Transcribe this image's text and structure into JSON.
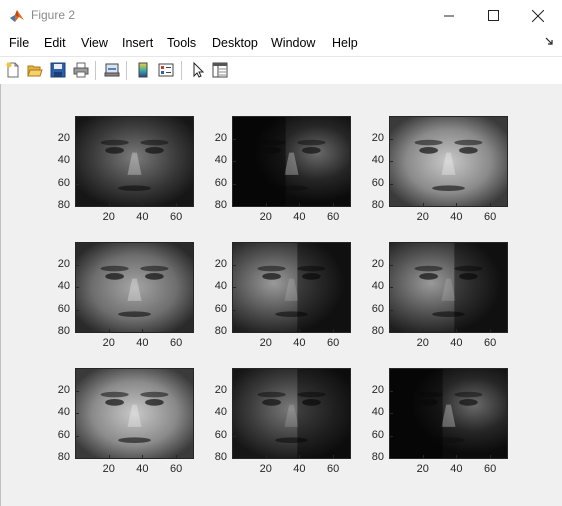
{
  "window": {
    "title": "Figure 2"
  },
  "menu": [
    "File",
    "Edit",
    "View",
    "Insert",
    "Tools",
    "Desktop",
    "Window",
    "Help"
  ],
  "toolbar": [
    "new-figure-icon",
    "open-file-icon",
    "save-icon",
    "print-icon",
    "link-plot-icon",
    "insert-colorbar-icon",
    "insert-legend-icon",
    "pointer-icon",
    "property-inspector-icon"
  ],
  "axes": {
    "ytick_labels": [
      "20",
      "40",
      "60",
      "80"
    ],
    "xtick_labels": [
      "20",
      "40",
      "60"
    ]
  },
  "faces": [
    {
      "brightness": "dark",
      "light_side": "center"
    },
    {
      "brightness": "very-dark",
      "light_side": "right"
    },
    {
      "brightness": "bright",
      "light_side": "even"
    },
    {
      "brightness": "medium",
      "light_side": "even"
    },
    {
      "brightness": "medium-dark",
      "light_side": "left"
    },
    {
      "brightness": "medium-dark",
      "light_side": "left"
    },
    {
      "brightness": "bright",
      "light_side": "even"
    },
    {
      "brightness": "dark",
      "light_side": "left"
    },
    {
      "brightness": "very-dark",
      "light_side": "right"
    }
  ]
}
